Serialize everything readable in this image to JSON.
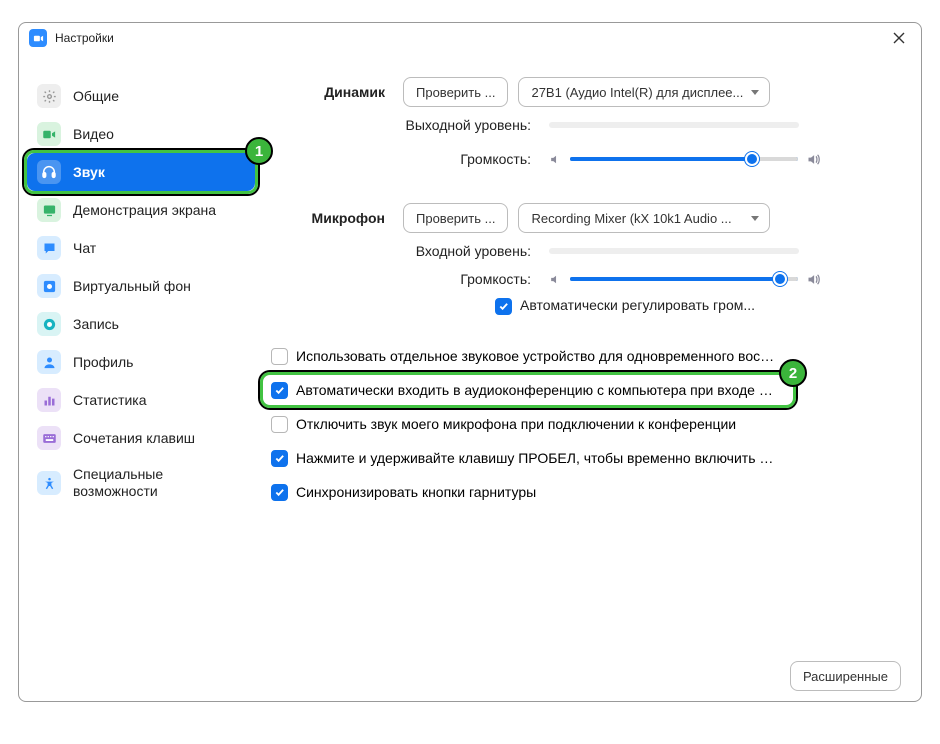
{
  "window": {
    "title": "Настройки"
  },
  "sidebar": {
    "items": [
      {
        "label": "Общие"
      },
      {
        "label": "Видео"
      },
      {
        "label": "Звук"
      },
      {
        "label": "Демонстрация экрана"
      },
      {
        "label": "Чат"
      },
      {
        "label": "Виртуальный фон"
      },
      {
        "label": "Запись"
      },
      {
        "label": "Профиль"
      },
      {
        "label": "Статистика"
      },
      {
        "label": "Сочетания клавиш"
      },
      {
        "label": "Специальные возможности"
      }
    ]
  },
  "speaker": {
    "section_label": "Динамик",
    "test_button": "Проверить ...",
    "device": "27B1 (Аудио Intel(R) для дисплее...",
    "output_level_label": "Выходной уровень:",
    "volume_label": "Громкость:",
    "volume_percent": 80
  },
  "mic": {
    "section_label": "Микрофон",
    "test_button": "Проверить ...",
    "device": "Recording Mixer (kX 10k1 Audio ...",
    "input_level_label": "Входной уровень:",
    "volume_label": "Громкость:",
    "volume_percent": 92,
    "auto_adjust_label": "Автоматически регулировать гром..."
  },
  "options": {
    "separate_device": "Использовать отдельное звуковое устройство для одновременного воспро...",
    "auto_join_audio": "Автоматически входить в аудиоконференцию с компьютера при входе в кон...",
    "mute_on_join": "Отключить звук моего микрофона при подключении к конференции",
    "push_to_talk": "Нажмите и удерживайте клавишу ПРОБЕЛ, чтобы временно включить свой з...",
    "sync_headset": "Синхронизировать кнопки гарнитуры"
  },
  "footer": {
    "advanced": "Расширенные"
  },
  "badges": {
    "one": "1",
    "two": "2"
  }
}
